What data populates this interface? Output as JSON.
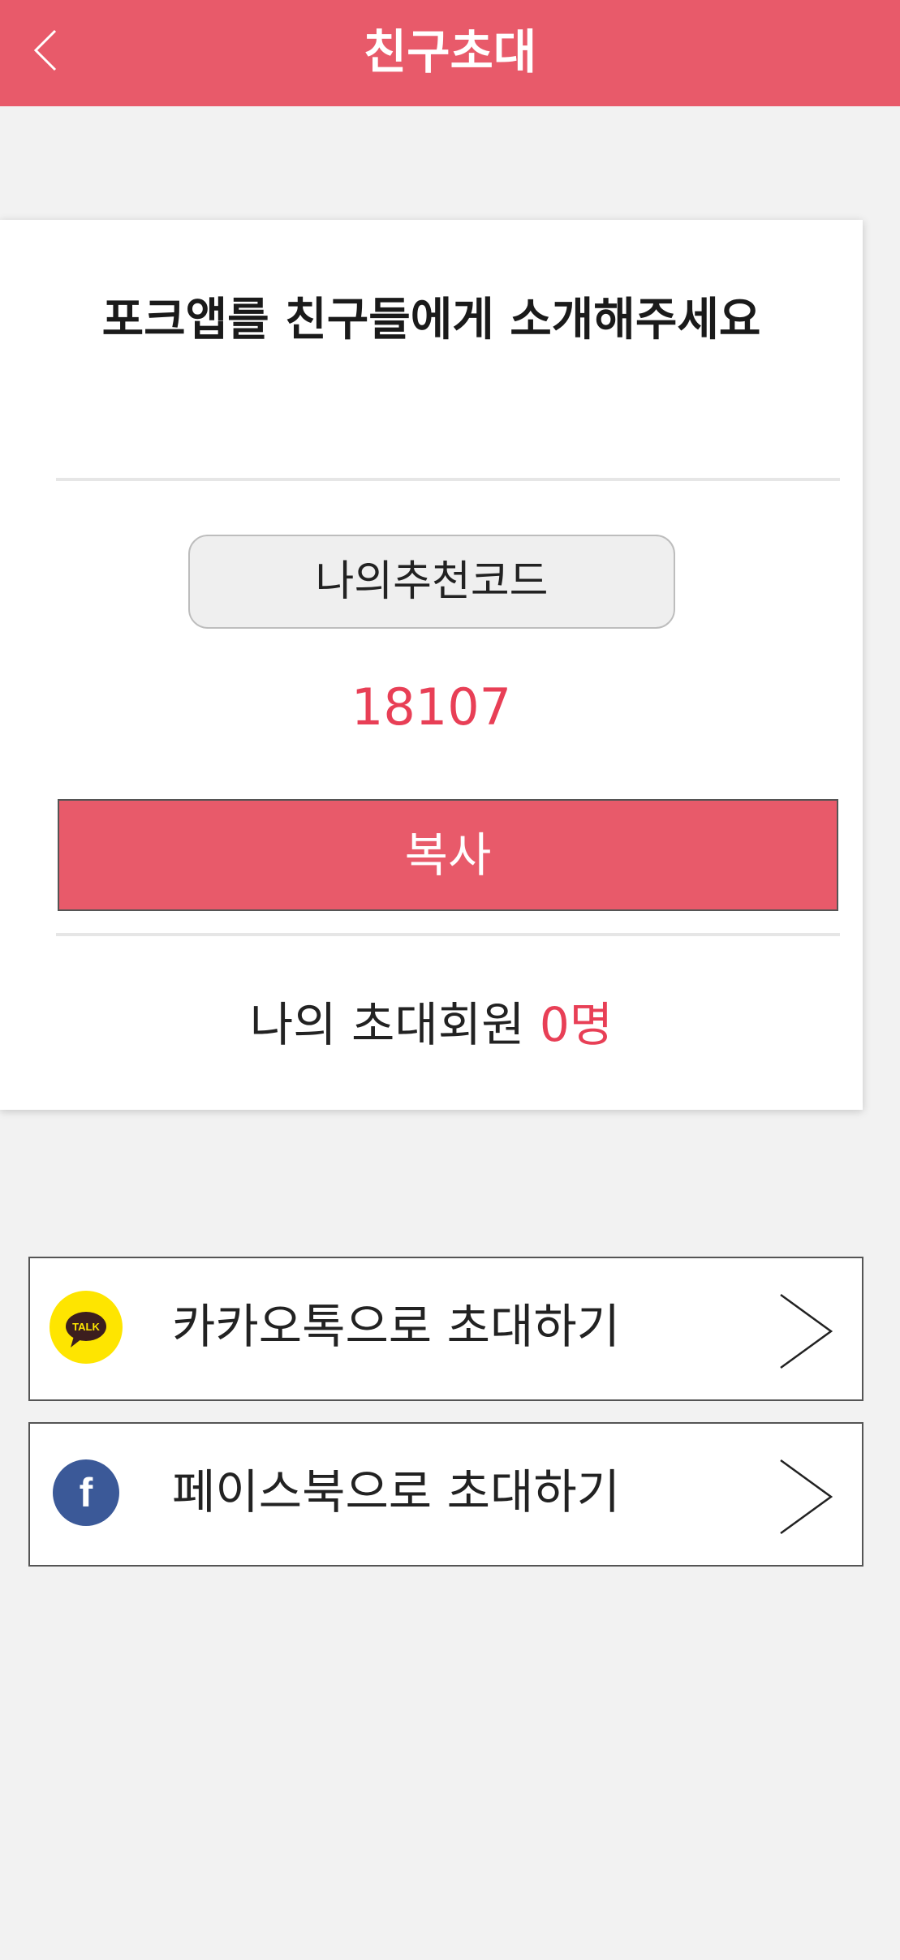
{
  "header": {
    "title": "친구초대",
    "back_icon": "chevron-left-icon"
  },
  "card": {
    "heading": "포크앱를 친구들에게 소개해주세요",
    "code_label": "나의추천코드",
    "code_value": "18107",
    "copy_label": "복사",
    "invite_label": "나의 초대회원",
    "invite_count": "0명"
  },
  "share": [
    {
      "label": "카카오톡으로 초대하기",
      "icon": "kakaotalk-icon",
      "icon_text": "TALK"
    },
    {
      "label": "페이스북으로 초대하기",
      "icon": "facebook-icon",
      "icon_text": "f"
    }
  ],
  "colors": {
    "primary": "#e85a6a",
    "accent_text": "#e83f56",
    "kakao_yellow": "#fee500",
    "facebook_blue": "#3b5998"
  }
}
